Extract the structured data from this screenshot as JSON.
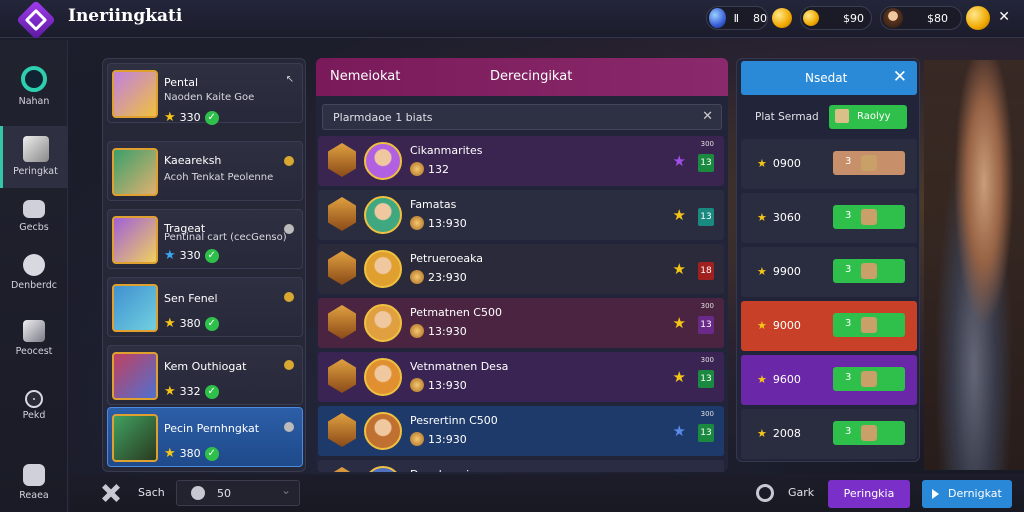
{
  "app": {
    "title": "Ineriingkati"
  },
  "currency": {
    "gems_prefix": "Ⅱ",
    "gems_value": "80",
    "gold_value": "$90",
    "player_value": "$80"
  },
  "nav": [
    {
      "label": "Nahan",
      "icon": "ring-icon"
    },
    {
      "label": "Peringkat",
      "icon": "cube-icon"
    },
    {
      "label": "Gecbs",
      "icon": "bag-icon"
    },
    {
      "label": "Denberdc",
      "icon": "note-icon"
    },
    {
      "label": "Peocest",
      "icon": "box-icon"
    },
    {
      "label": "Pekd",
      "icon": "shield-icon"
    },
    {
      "label": "Reaea",
      "icon": "gear-icon"
    }
  ],
  "heroes": [
    {
      "name": "Pental",
      "sub": "Naoden Kaite Goe",
      "score": "330",
      "star": "gold",
      "tint": "#c080e0"
    },
    {
      "name": "Kaeareksh",
      "sub": "Acoh Tenkat Peolenne",
      "score": "",
      "star": "",
      "tint": "#40b070"
    },
    {
      "name": "Trageat",
      "sub": "Pentinal cart (cecGenso)",
      "score": "330",
      "star": "blue",
      "tint": "#a060d8"
    },
    {
      "name": "Sen Fenel",
      "sub": "",
      "score": "380",
      "star": "gold",
      "tint": "#4090d0"
    },
    {
      "name": "Kem Outhiogat",
      "sub": "",
      "score": "332",
      "star": "gold",
      "tint": "#c04060"
    },
    {
      "name": "Pecin Pernhngkat",
      "sub": "",
      "score": "380",
      "star": "gold",
      "tint": "#40a060"
    }
  ],
  "center": {
    "header_left": "Nemeiokat",
    "header_right": "Derecingikat",
    "search_text": "Plarmdaoe 1 biats",
    "rows": [
      {
        "title": "Cikanmarites",
        "value": "132",
        "star": "purple",
        "chip": "13",
        "tiny": "300",
        "bg": "#3a2450",
        "face": "#b060e0",
        "chip_bg": "#1a8a40"
      },
      {
        "title": "Famatas",
        "value": "13:930",
        "star": "gold",
        "chip": "13",
        "tiny": "",
        "bg": "#2a2c40",
        "face": "#40a880",
        "chip_bg": "#1a8a80"
      },
      {
        "title": "Petrueroeaka",
        "value": "23:930",
        "star": "gold",
        "chip": "18",
        "tiny": "",
        "bg": "#2a2a3a",
        "face": "#e0a030",
        "chip_bg": "#a02020"
      },
      {
        "title": "Petmatnen C500",
        "value": "13:930",
        "star": "gold",
        "chip": "13",
        "tiny": "300",
        "bg": "#4a2440",
        "face": "#e0a040",
        "chip_bg": "#6a2a8a"
      },
      {
        "title": "Vetnmatnen Desa",
        "value": "13:930",
        "star": "gold",
        "chip": "13",
        "tiny": "300",
        "bg": "#3a2454",
        "face": "#e09030",
        "chip_bg": "#1a8a40"
      },
      {
        "title": "Pesrertinn C500",
        "value": "13:930",
        "star": "blue",
        "chip": "13",
        "tiny": "300",
        "bg": "#1e3a6a",
        "face": "#c07030",
        "chip_bg": "#1a8a40"
      },
      {
        "title": "Daoehnaei",
        "value": "",
        "star": "",
        "chip": "",
        "tiny": "",
        "bg": "#2a2c44",
        "face": "#5070c0",
        "chip_bg": "#1a8a40"
      }
    ]
  },
  "right": {
    "header": "Nsedat",
    "sub_label": "Plat Sermad",
    "sub_button": "Raolyy",
    "rows": [
      {
        "label": "0900",
        "btn": "3",
        "btn_style": "brown",
        "bg": "#2a2c40"
      },
      {
        "label": "3060",
        "btn": "3",
        "btn_style": "green",
        "bg": "#2a2c40"
      },
      {
        "label": "9900",
        "btn": "3",
        "btn_style": "green",
        "bg": "#2a2c40"
      },
      {
        "label": "9000",
        "btn": "3",
        "btn_style": "green",
        "bg": "#c84028"
      },
      {
        "label": "9600",
        "btn": "3",
        "btn_style": "green",
        "bg": "#6a28a8"
      },
      {
        "label": "2008",
        "btn": "3",
        "btn_style": "green",
        "bg": "#2a2c40"
      }
    ]
  },
  "bottom": {
    "sort_label": "Sach",
    "field_value": "50",
    "back_label": "Gark",
    "btn_primary": "Peringkia",
    "btn_secondary": "Dernigkat"
  }
}
